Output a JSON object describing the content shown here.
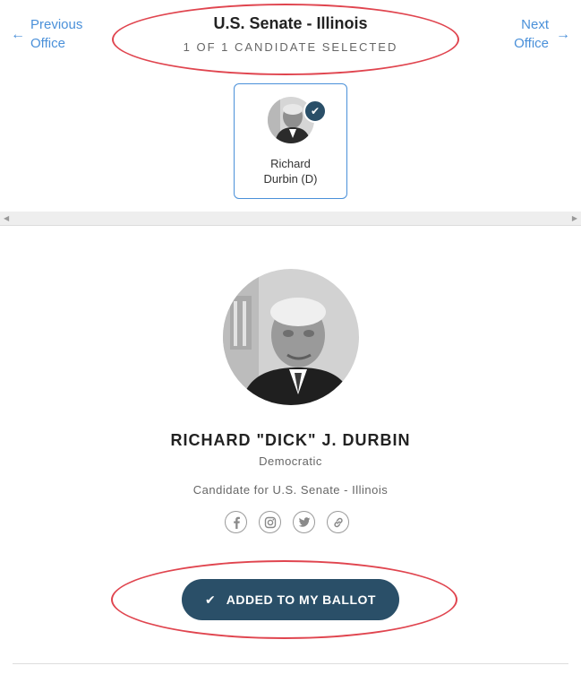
{
  "header": {
    "previous_label": "Previous Office",
    "previous_line1": "Previous",
    "previous_line2": "Office",
    "next_label": "Next Office",
    "next_line1": "Next",
    "next_line2": "Office",
    "office_title": "U.S. Senate - Illinois",
    "selection_status": "1 OF 1 CANDIDATE SELECTED"
  },
  "carousel": {
    "cards": [
      {
        "name_line1": "Richard",
        "name_line2": "Durbin (D)",
        "selected": true
      }
    ]
  },
  "candidate": {
    "name": "RICHARD \"DICK\" J. DURBIN",
    "party": "Democratic",
    "office": "Candidate for U.S. Senate - Illinois",
    "socials": [
      "facebook-icon",
      "instagram-icon",
      "twitter-icon",
      "link-icon"
    ],
    "button_label": "ADDED TO MY BALLOT"
  },
  "colors": {
    "accent": "#4a90d9",
    "button": "#2a4f68",
    "annotation": "#e0454f"
  }
}
